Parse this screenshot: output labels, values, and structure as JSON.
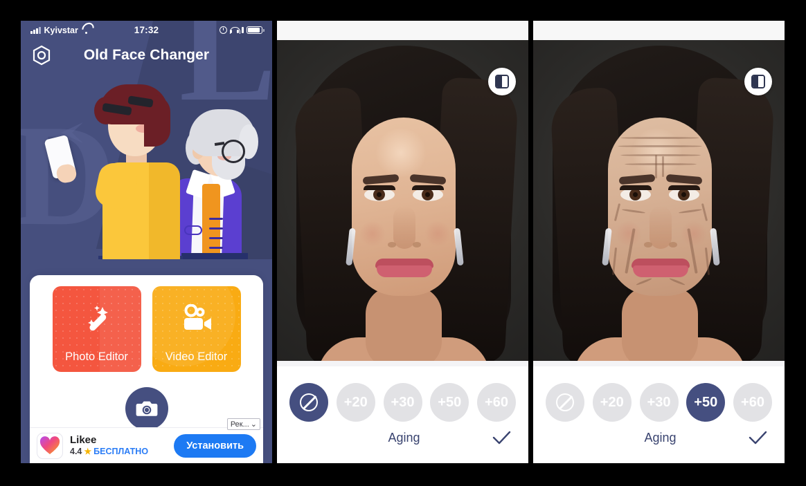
{
  "app": {
    "name": "Old Face Changer",
    "settings_icon": "hexagon-settings-icon"
  },
  "status_bar": {
    "carrier": "Kyivstar",
    "time": "17:32",
    "signal_icon": "signal-bars-icon",
    "wifi_icon": "wifi-icon",
    "alarm_icon": "alarm-clock-icon",
    "headphones_icon": "headphones-icon",
    "battery_icon": "battery-icon"
  },
  "home": {
    "tiles": [
      {
        "label": "Photo Editor",
        "icon": "magic-wand-icon",
        "color": "#f4563f"
      },
      {
        "label": "Video Editor",
        "icon": "video-camera-icon",
        "color": "#f9ab13"
      }
    ],
    "camera_button_icon": "camera-icon"
  },
  "ad": {
    "app_name": "Likee",
    "rating": "4.4",
    "star": "★",
    "price_label": "БЕСПЛАТНО",
    "install_label": "Установить",
    "tag_label": "Рек...",
    "tag_chevron": "⌄",
    "icon": "likee-heart-icon"
  },
  "editor": {
    "compare_icon": "compare-before-after-icon",
    "age_options": [
      {
        "label": "",
        "icon": "no-effect-ban-icon",
        "value": "none"
      },
      {
        "label": "+20",
        "value": "20"
      },
      {
        "label": "+30",
        "value": "30"
      },
      {
        "label": "+50",
        "value": "50"
      },
      {
        "label": "+60",
        "value": "60"
      }
    ],
    "tool_title": "Aging",
    "confirm_icon": "checkmark-icon",
    "panel_2_selected": "none",
    "panel_3_selected": "50"
  },
  "colors": {
    "brand_navy": "#454f80",
    "accent_red": "#f4563f",
    "accent_orange": "#f9ab13",
    "ad_blue": "#1d7af3",
    "inactive_gray": "#e2e2e5"
  }
}
